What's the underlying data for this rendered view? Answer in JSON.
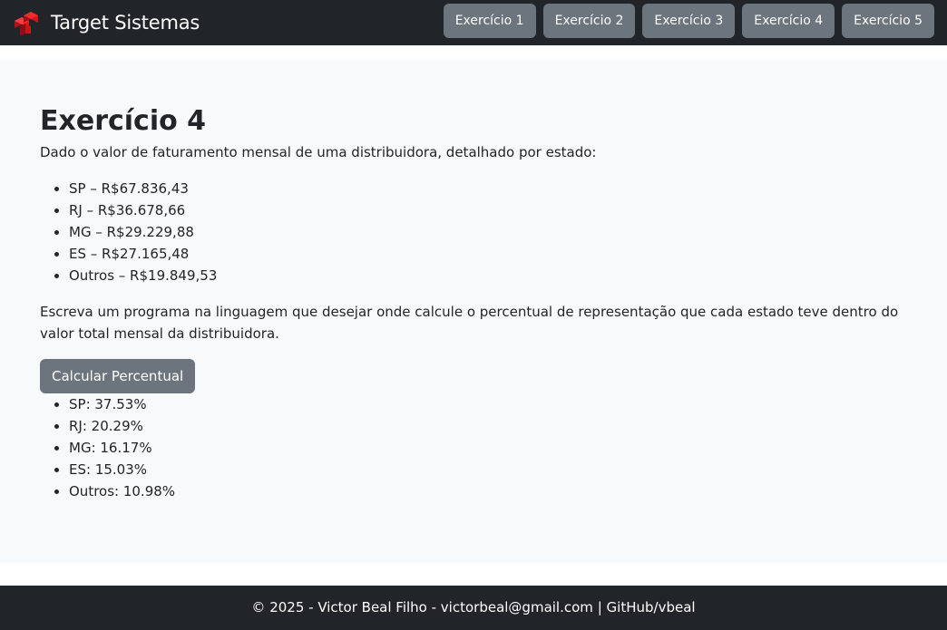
{
  "brand": {
    "name": "Target Sistemas",
    "logo_icon": "red-cubes-logo-icon",
    "logo_color": "#e01b22"
  },
  "nav": {
    "buttons": [
      {
        "label": "Exercício 1"
      },
      {
        "label": "Exercício 2"
      },
      {
        "label": "Exercício 3"
      },
      {
        "label": "Exercício 4"
      },
      {
        "label": "Exercício 5"
      }
    ]
  },
  "main": {
    "title": "Exercício 4",
    "intro": "Dado o valor de faturamento mensal de uma distribuidora, detalhado por estado:",
    "states": [
      {
        "text": "SP – R$67.836,43"
      },
      {
        "text": "RJ – R$36.678,66"
      },
      {
        "text": "MG – R$29.229,88"
      },
      {
        "text": "ES – R$27.165,48"
      },
      {
        "text": "Outros – R$19.849,53"
      }
    ],
    "task": "Escreva um programa na linguagem que desejar onde calcule o percentual de representação que cada estado teve dentro do valor total mensal da distribuidora.",
    "calc_button": "Calcular Percentual",
    "results": [
      {
        "text": "SP: 37.53%"
      },
      {
        "text": "RJ: 20.29%"
      },
      {
        "text": "MG: 16.17%"
      },
      {
        "text": "ES: 15.03%"
      },
      {
        "text": "Outros: 10.98%"
      }
    ]
  },
  "footer": {
    "copyright": "© 2025 - Victor Beal Filho - victorbeal@gmail.com",
    "separator": "|",
    "github_link": "GitHub/vbeal"
  },
  "colors": {
    "navbar_bg": "#212529",
    "button_bg": "#6c757d",
    "main_bg": "#f8f9fa",
    "footer_bg": "#212529"
  }
}
